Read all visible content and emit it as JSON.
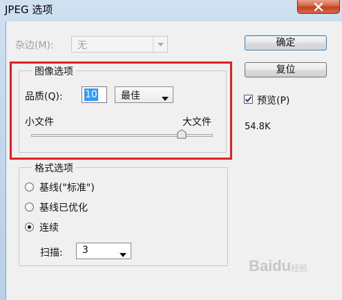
{
  "window": {
    "title": "JPEG 选项"
  },
  "matte": {
    "label": "杂边(M):",
    "mnemonic": "M",
    "value": "无"
  },
  "image_options": {
    "group_title": "图像选项",
    "quality_label": "品质(Q):",
    "quality_mnemonic": "Q",
    "quality_value": "10",
    "quality_preset": "最佳",
    "slider_min_label": "小文件",
    "slider_max_label": "大文件",
    "slider_fraction": 0.83
  },
  "buttons": {
    "ok": "确定",
    "reset": "复位"
  },
  "preview": {
    "label": "预览(P)",
    "checked": true,
    "file_size": "54.8K"
  },
  "format_options": {
    "group_title": "格式选项",
    "options": [
      {
        "label": "基线(\"标准\")",
        "selected": false
      },
      {
        "label": "基线已优化",
        "selected": false
      },
      {
        "label": "连续",
        "selected": true
      }
    ],
    "scans_label": "扫描:",
    "scans_value": "3"
  },
  "highlight_color": "#e02020",
  "watermark": {
    "text": "Baidu",
    "sub": "经验"
  }
}
